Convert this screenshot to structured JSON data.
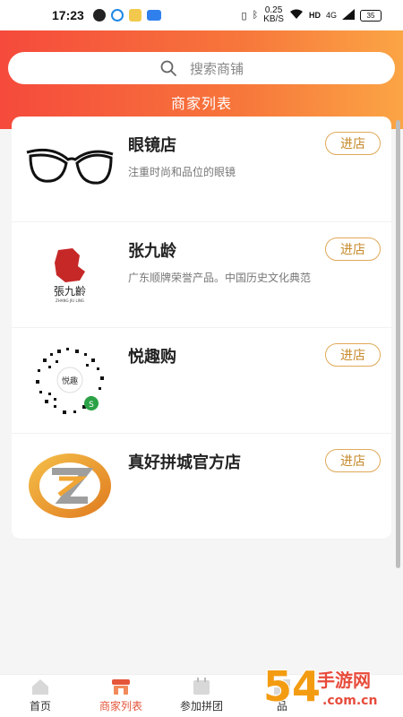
{
  "status_bar": {
    "time": "17:23",
    "net_speed_value": "0.25",
    "net_speed_unit": "KB/S",
    "network_type": "4G",
    "battery": "35"
  },
  "header": {
    "search_placeholder": "搜索商铺",
    "title": "商家列表",
    "gradient_start": "#f54a3c",
    "gradient_end": "#fba545"
  },
  "stores": [
    {
      "name": "眼镜店",
      "desc": "注重时尚和品位的眼镜",
      "button": "进店",
      "logo_icon": "glasses-icon"
    },
    {
      "name": "张九龄",
      "desc": "广东顺牌荣誉产品。中国历史文化典范",
      "button": "进店",
      "logo_icon": "zhangjiuling-logo"
    },
    {
      "name": "悦趣购",
      "desc": "",
      "button": "进店",
      "logo_icon": "mini-program-code"
    },
    {
      "name": "真好拼城官方店",
      "desc": "",
      "button": "进店",
      "logo_icon": "zh-logo"
    }
  ],
  "tabs": [
    {
      "label": "首页",
      "icon": "home-icon",
      "active": false
    },
    {
      "label": "商家列表",
      "icon": "store-icon",
      "active": true
    },
    {
      "label": "参加拼团",
      "icon": "group-icon",
      "active": false
    },
    {
      "label": "品",
      "icon": "category-icon",
      "active": false
    }
  ],
  "watermark": {
    "text_main": "手游网",
    "text_sub": ".com.cn",
    "number": "54"
  },
  "accent_color": "#e4553a",
  "button_color": "#c78a2c"
}
